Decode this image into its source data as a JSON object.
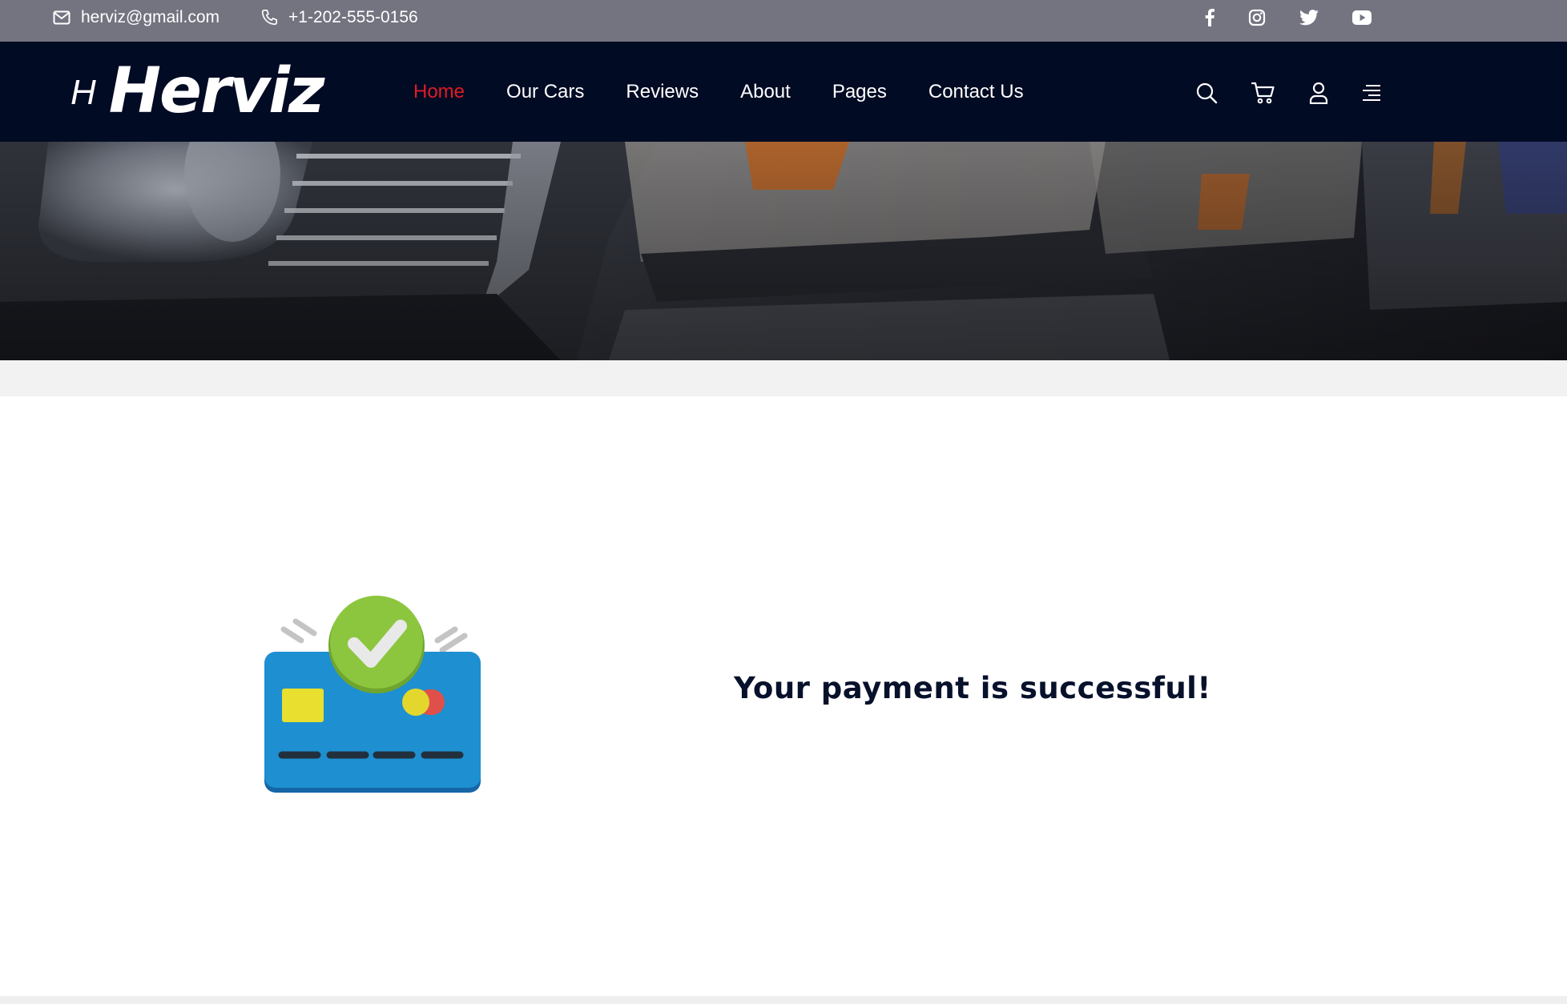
{
  "topbar": {
    "email": "herviz@gmail.com",
    "phone": "+1-202-555-0156",
    "email_icon": "envelope-icon",
    "phone_icon": "phone-icon",
    "socials": [
      "facebook-icon",
      "instagram-icon",
      "twitter-icon",
      "youtube-icon"
    ]
  },
  "header": {
    "logo_mark": "H",
    "logo_text": "Herviz",
    "nav": [
      {
        "label": "Home",
        "active": true
      },
      {
        "label": "Our Cars",
        "active": false
      },
      {
        "label": "Reviews",
        "active": false
      },
      {
        "label": "About",
        "active": false
      },
      {
        "label": "Pages",
        "active": false
      },
      {
        "label": "Contact Us",
        "active": false
      }
    ],
    "icons": [
      "search-icon",
      "cart-icon",
      "user-icon",
      "menu-icon"
    ]
  },
  "main": {
    "message": "Your payment is successful!",
    "illustration": "payment-success-card-icon"
  },
  "colors": {
    "topbar_bg": "#737480",
    "navbar_bg": "#020b24",
    "accent": "#e11a24",
    "card_blue": "#1e8fd0",
    "check_green": "#8cc63f"
  }
}
